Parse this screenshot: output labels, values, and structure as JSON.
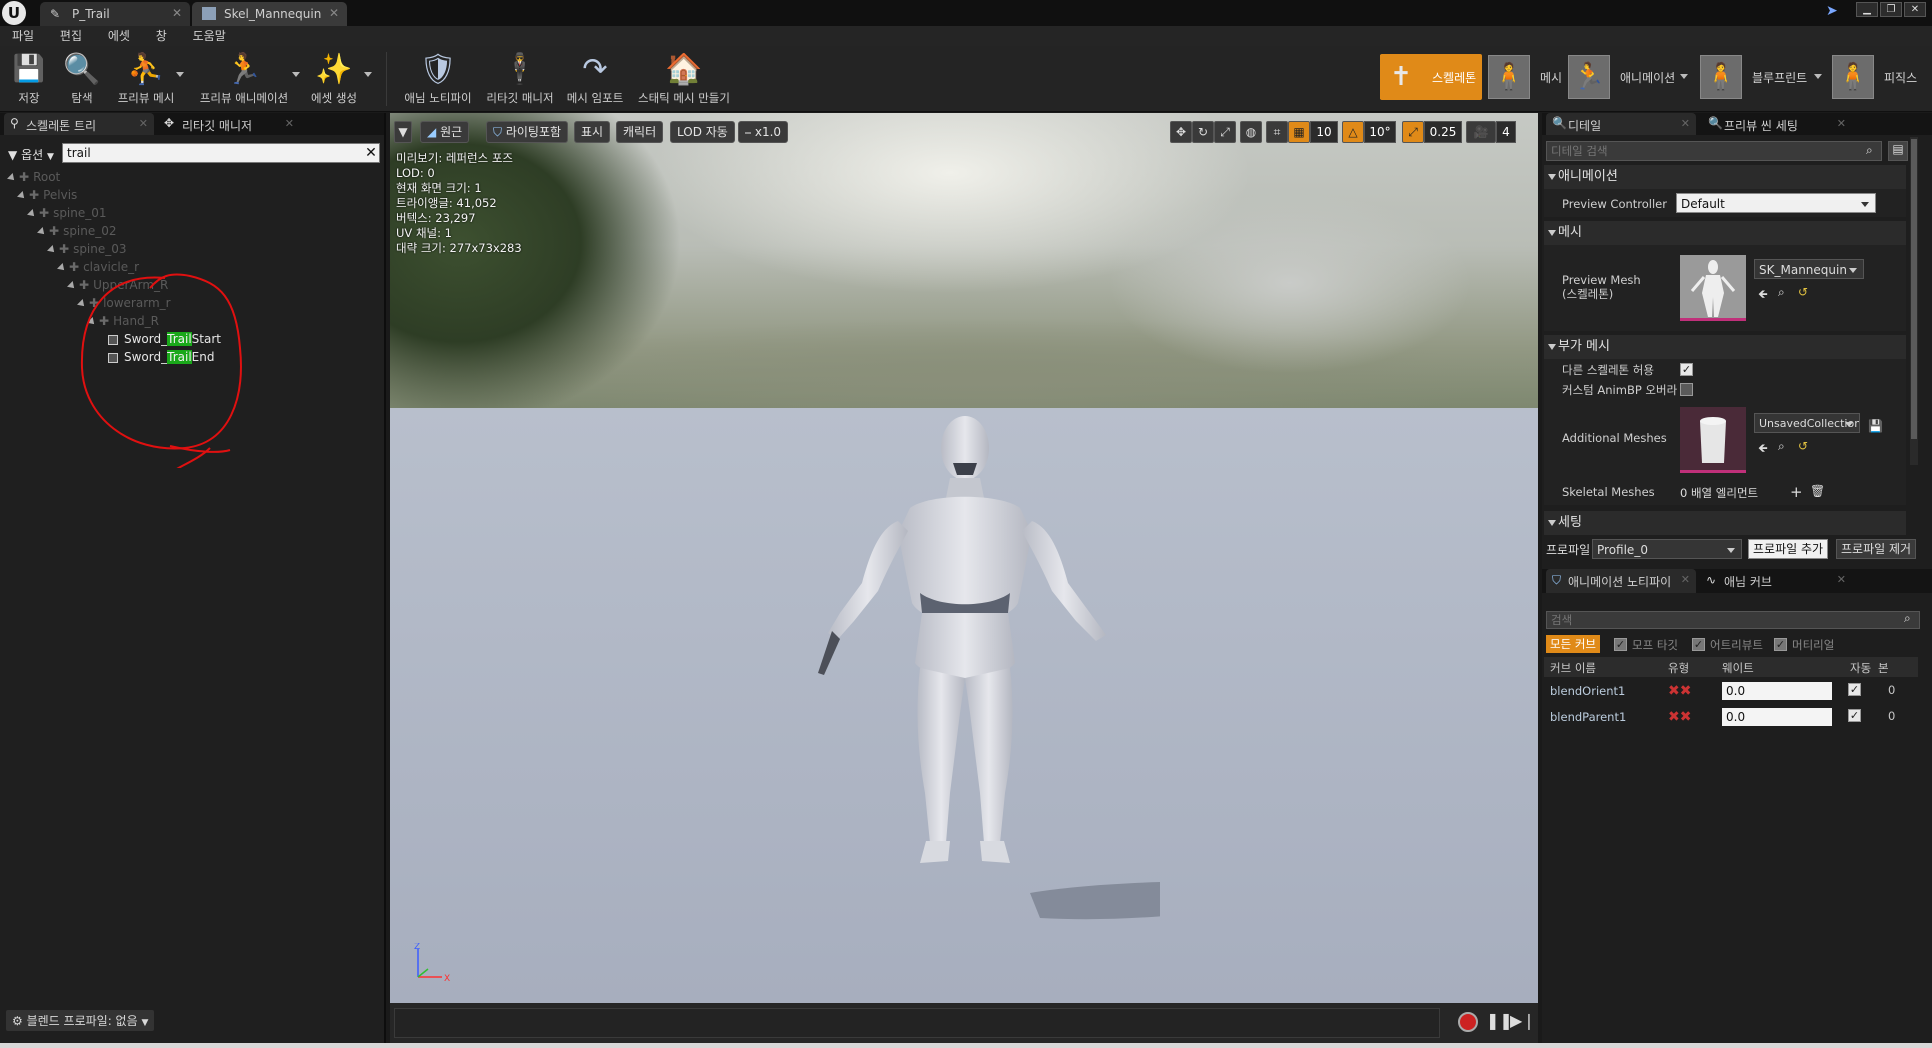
{
  "titlebar": {
    "tabs": [
      {
        "label": "P_Trail"
      },
      {
        "label": "Skel_Mannequin"
      }
    ]
  },
  "menubar": {
    "items": [
      "파일",
      "편집",
      "에셋",
      "창",
      "도움말"
    ]
  },
  "toolbar": {
    "buttons": [
      {
        "label": "저장",
        "icon": "save-icon"
      },
      {
        "label": "탐색",
        "icon": "browse-icon"
      },
      {
        "label": "프리뷰 메시",
        "icon": "preview-mesh-icon"
      },
      {
        "label": "프리뷰 애니메이션",
        "icon": "preview-animation-icon"
      },
      {
        "label": "에셋 생성",
        "icon": "create-asset-icon"
      },
      {
        "label": "애님 노티파이",
        "icon": "anim-notify-icon"
      },
      {
        "label": "리타깃 매니저",
        "icon": "retarget-manager-icon"
      },
      {
        "label": "메시 임포트",
        "icon": "import-mesh-icon"
      },
      {
        "label": "스태틱 메시 만들기",
        "icon": "make-static-mesh-icon"
      }
    ],
    "modes": [
      {
        "label": "스켈레톤",
        "active": true
      },
      {
        "label": "메시",
        "active": false
      },
      {
        "label": "애니메이션",
        "active": false
      },
      {
        "label": "블루프린트",
        "active": false
      },
      {
        "label": "피직스",
        "active": false
      }
    ]
  },
  "left_panel": {
    "tabs": [
      "스켈레톤 트리",
      "리타깃 매니저"
    ],
    "options_label": "옵션",
    "search_value": "trail",
    "tree": [
      {
        "label": "Root",
        "type": "bone"
      },
      {
        "label": "Pelvis",
        "type": "bone"
      },
      {
        "label": "spine_01",
        "type": "bone"
      },
      {
        "label": "spine_02",
        "type": "bone"
      },
      {
        "label": "spine_03",
        "type": "bone"
      },
      {
        "label": "clavicle_r",
        "type": "bone"
      },
      {
        "label": "UpperArm_R",
        "type": "bone"
      },
      {
        "label": "lowerarm_r",
        "type": "bone"
      },
      {
        "label": "Hand_R",
        "type": "bone"
      },
      {
        "label_pre": "Sword_",
        "label_hl": "Trail",
        "label_post": "Start",
        "type": "socket"
      },
      {
        "label_pre": "Sword_",
        "label_hl": "Trail",
        "label_post": "End",
        "type": "socket"
      }
    ],
    "blend_profile": "블렌드 프로파일: 없음"
  },
  "viewport": {
    "toolbar": {
      "perspective": "원근",
      "lighting": "라이팅포함",
      "show": "표시",
      "character": "캐릭터",
      "lod": "LOD 자동",
      "speed": "x1.0",
      "grid_snap": "10",
      "rot_snap": "10°",
      "scale_snap": "0.25",
      "camera_speed": "4"
    },
    "info": [
      "미리보기: 레퍼런스 포즈",
      "LOD: 0",
      "현재 화면 크기: 1",
      "트라이앵글: 41,052",
      "버텍스: 23,297",
      "UV 채널: 1",
      "대략 크기: 277x73x283"
    ]
  },
  "right_panel": {
    "tabs": [
      "디테일",
      "프리뷰 씬 세팅"
    ],
    "search_placeholder": "디테일 검색",
    "sections": {
      "animation": "애니메이션",
      "mesh": "메시",
      "additional": "부가 메시",
      "settings": "세팅"
    },
    "preview_controller_label": "Preview Controller",
    "preview_controller_value": "Default",
    "preview_mesh_label": "Preview Mesh\n(스켈레톤)",
    "preview_mesh_label_1": "Preview Mesh",
    "preview_mesh_label_2": "(스켈레톤)",
    "preview_mesh_value": "SK_Mannequin",
    "allow_other_skel_label": "다른 스켈레톤 허용",
    "custom_animbp_label": "커스텀 AnimBP 오버라",
    "additional_meshes_label": "Additional Meshes",
    "additional_meshes_value": "UnsavedCollection",
    "skeletal_meshes_label": "Skeletal Meshes",
    "skeletal_meshes_value": "0 배열 엘리먼트",
    "profile_label": "프로파일",
    "profile_value": "Profile_0",
    "add_profile": "프로파일 추가",
    "remove_profile": "프로파일 제거",
    "bottom_tabs": [
      "애니메이션 노티파이",
      "애님 커브"
    ],
    "curve_search_placeholder": "검색",
    "filters": {
      "all": "모든 커브",
      "morph": "모프 타깃",
      "attribute": "어트리뷰트",
      "material": "머티리얼"
    },
    "curve_headers": [
      "커브 이름",
      "유형",
      "웨이트",
      "자동",
      "본"
    ],
    "curves": [
      {
        "name": "blendOrient1",
        "weight": "0.0",
        "bone": "0"
      },
      {
        "name": "blendParent1",
        "weight": "0.0",
        "bone": "0"
      }
    ]
  },
  "colors": {
    "accent_orange": "#e08a18",
    "highlight_green": "#1aa81a",
    "annotation_red": "#e01010"
  }
}
